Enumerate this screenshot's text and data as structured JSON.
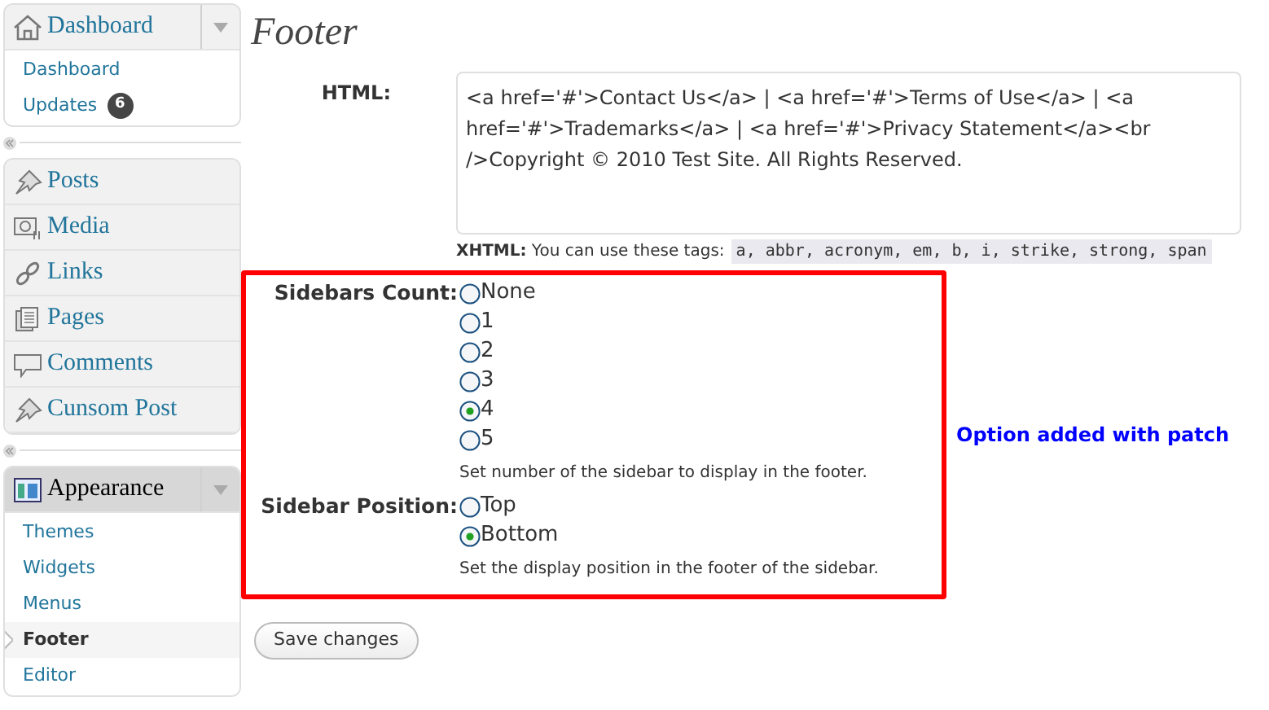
{
  "menu": [
    {
      "items": [
        {
          "label": "Dashboard",
          "current": false,
          "submenu": [
            {
              "label": "Dashboard",
              "selected": false
            },
            {
              "label": "Updates",
              "selected": false,
              "badge": "6"
            }
          ]
        }
      ]
    },
    {
      "items": [
        {
          "label": "Posts",
          "current": false
        },
        {
          "label": "Media",
          "current": false
        },
        {
          "label": "Links",
          "current": false
        },
        {
          "label": "Pages",
          "current": false
        },
        {
          "label": "Comments",
          "current": false
        },
        {
          "label": "Cunsom Post",
          "current": false
        }
      ]
    },
    {
      "items": [
        {
          "label": "Appearance",
          "current": true,
          "submenu": [
            {
              "label": "Themes",
              "selected": false
            },
            {
              "label": "Widgets",
              "selected": false
            },
            {
              "label": "Menus",
              "selected": false
            },
            {
              "label": "Footer",
              "selected": true
            },
            {
              "label": "Editor",
              "selected": false
            }
          ]
        }
      ]
    }
  ],
  "page_title": "Footer",
  "html_field": {
    "label": "HTML:",
    "value": "<a href='#'>Contact Us</a> | <a href='#'>Terms of Use</a> | <a href='#'>Trademarks</a> | <a href='#'>Privacy Statement</a><br />Copyright © 2010 Test Site. All Rights Reserved.",
    "hint_label": "XHTML:",
    "hint": "You can use these tags:",
    "tags": "a, abbr, acronym, em, b, i, strike, strong, span"
  },
  "options": [
    {
      "label": "Sidebars Count:",
      "choices": [
        {
          "label": "None",
          "selected": false
        },
        {
          "label": "1",
          "selected": false
        },
        {
          "label": "2",
          "selected": false
        },
        {
          "label": "3",
          "selected": false
        },
        {
          "label": "4",
          "selected": true
        },
        {
          "label": "5",
          "selected": false
        }
      ],
      "hint": "Set number of the sidebar to display in the footer."
    },
    {
      "label": "Sidebar Position:",
      "choices": [
        {
          "label": "Top",
          "selected": false
        },
        {
          "label": "Bottom",
          "selected": true
        }
      ],
      "hint": "Set the display position in the footer of the sidebar."
    }
  ],
  "annotation": "Option added with patch",
  "save_button": "Save changes"
}
